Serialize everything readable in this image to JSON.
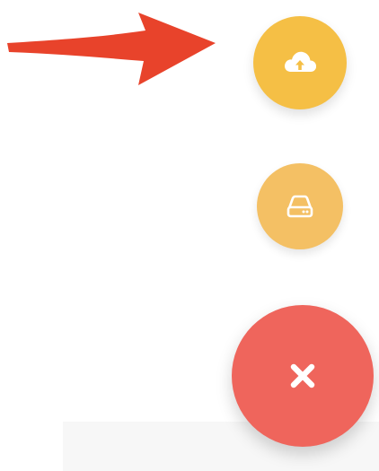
{
  "colors": {
    "arrow": "#e8432b",
    "upload_fab": "#f5bf45",
    "storage_fab": "#f4c064",
    "close_fab": "#ef655c",
    "icon": "#ffffff"
  },
  "annotation": {
    "icon": "arrow-right-icon"
  },
  "fab_menu": {
    "items": [
      {
        "icon": "cloud-upload-icon"
      },
      {
        "icon": "hard-drive-icon"
      }
    ],
    "close": {
      "icon": "close-icon"
    }
  }
}
